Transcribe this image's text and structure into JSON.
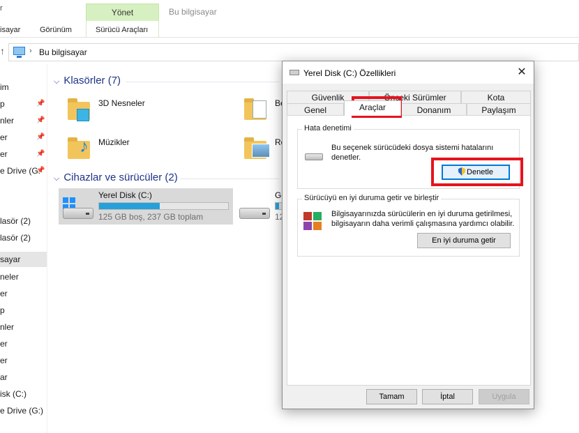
{
  "ribbon": {
    "stub_label": "r",
    "manage_tab": "Yönet",
    "location_title": "Bu bilgisayar",
    "tabs": [
      "isayar",
      "Görünüm",
      "Sürücü Araçları"
    ]
  },
  "address": {
    "path": "Bu bilgisayar",
    "icon": "this-pc-icon"
  },
  "nav": {
    "items": [
      {
        "label": "im",
        "pinned": false
      },
      {
        "label": "p",
        "pinned": true
      },
      {
        "label": "nler",
        "pinned": true
      },
      {
        "label": "er",
        "pinned": true
      },
      {
        "label": "er",
        "pinned": true
      },
      {
        "label": "e Drive (G:",
        "pinned": true
      },
      {
        "label": "lasör (2)",
        "pinned": false
      },
      {
        "label": "lasör (2)",
        "pinned": false
      },
      {
        "label": "sayar",
        "pinned": false,
        "selected": true
      },
      {
        "label": "neler",
        "pinned": false
      },
      {
        "label": "er",
        "pinned": false
      },
      {
        "label": "p",
        "pinned": false
      },
      {
        "label": "nler",
        "pinned": false
      },
      {
        "label": "er",
        "pinned": false
      },
      {
        "label": "er",
        "pinned": false
      },
      {
        "label": "ar",
        "pinned": false
      },
      {
        "label": "isk (C:)",
        "pinned": false
      },
      {
        "label": "e Drive (G:)",
        "pinned": false
      }
    ]
  },
  "content": {
    "folders_header": "Klasörler (7)",
    "folders": [
      "3D Nesneler",
      "Belgeler",
      "Müzikler",
      "Resimler"
    ],
    "folders_visible": [
      "3D Nesneler",
      "Be",
      "Müzikler",
      "Re"
    ],
    "devices_header": "Cihazlar ve sürücüler (2)",
    "drives": [
      {
        "name": "Yerel Disk (C:)",
        "size_text": "125 GB boş, 237 GB toplam",
        "used_fraction": 0.47
      },
      {
        "name": "Go",
        "size_text": "12",
        "used_fraction": 0.5
      }
    ]
  },
  "dialog": {
    "title": "Yerel Disk (C:) Özellikleri",
    "close_symbol": "✕",
    "tabs_row1": [
      "Güvenlik",
      "Önceki Sürümler",
      "Kota"
    ],
    "tabs_row2": [
      "Genel",
      "Araçlar",
      "Donanım",
      "Paylaşım"
    ],
    "active_tab": "Araçlar",
    "error_check": {
      "title": "Hata denetimi",
      "text_line1": "Bu seçenek sürücüdeki dosya sistemi hatalarını",
      "text_line2": "denetler.",
      "button": "Denetle"
    },
    "optimize": {
      "title": "Sürücüyü en iyi duruma getir ve birleştir",
      "text_line1": "Bilgisayarınızda sürücülerin en iyi duruma getirilmesi,",
      "text_line2": "bilgisayarın daha verimli çalışmasına yardımcı olabilir.",
      "button": "En iyi duruma getir"
    },
    "buttons": {
      "ok": "Tamam",
      "cancel": "İptal",
      "apply": "Uygula"
    }
  },
  "highlight_color": "#e4141e",
  "accent_color": "#26a0da"
}
